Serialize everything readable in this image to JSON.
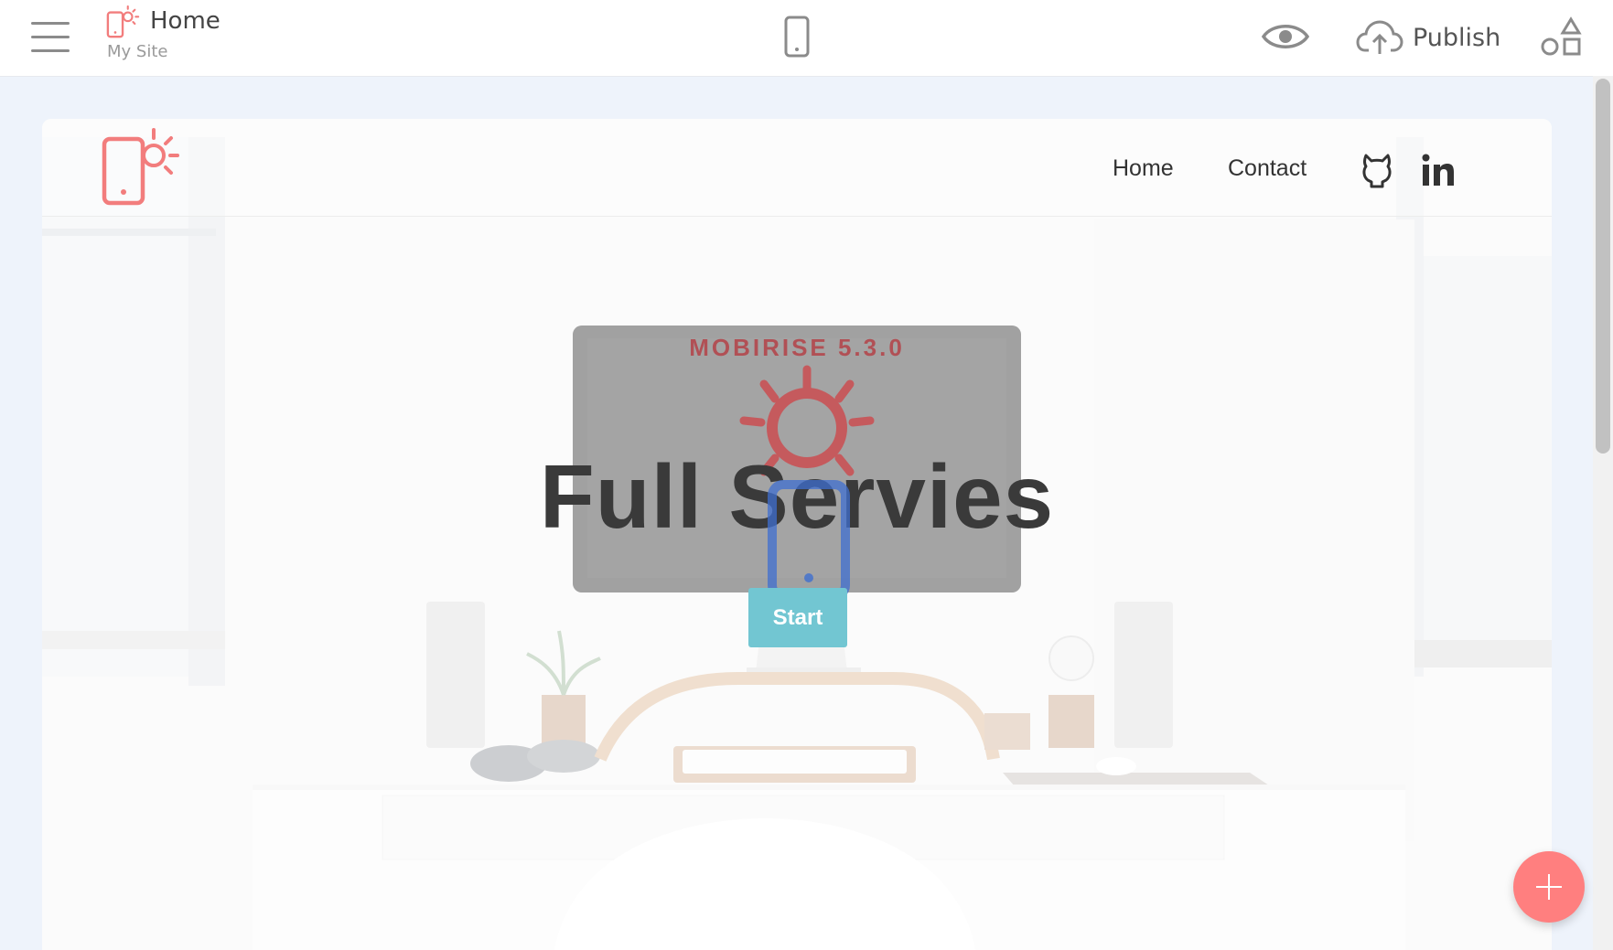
{
  "toolbar": {
    "page_name": "Home",
    "site_name": "My Site",
    "publish_label": "Publish",
    "icons": [
      "menu-icon",
      "logo-icon",
      "mobile-device-icon",
      "eye-icon",
      "cloud-upload-icon",
      "blocks-icon"
    ]
  },
  "site": {
    "nav": {
      "items": [
        {
          "label": "Home"
        },
        {
          "label": "Contact"
        }
      ],
      "social_icons": [
        "github-icon",
        "linkedin-icon"
      ]
    },
    "hero": {
      "monitor_text": "MOBIRISE  5.3.0",
      "title": "Full Servies",
      "button_label": "Start"
    }
  },
  "colors": {
    "accent": "#ff7f7f",
    "button": "#72c6d2",
    "brand_red": "#f27d7d"
  }
}
